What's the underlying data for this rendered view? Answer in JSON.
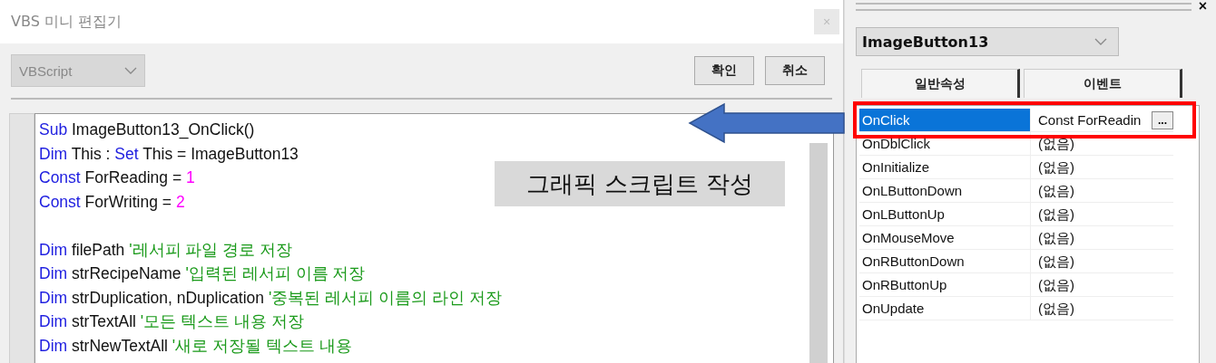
{
  "editor_window": {
    "title": "VBS 미니 편집기",
    "close": "×",
    "language_dropdown": {
      "value": "VBScript",
      "disabled": true
    },
    "buttons": [
      "확인",
      "취소"
    ],
    "code_lines": [
      {
        "segments": [
          {
            "kind": "keyword",
            "text": "Sub"
          },
          {
            "kind": "plain",
            "text": " ImageButton13_OnClick()"
          }
        ]
      },
      {
        "segments": [
          {
            "kind": "keyword",
            "text": "Dim"
          },
          {
            "kind": "plain",
            "text": " This : "
          },
          {
            "kind": "keyword",
            "text": "Set"
          },
          {
            "kind": "plain",
            "text": " This = ImageButton13"
          }
        ]
      },
      {
        "segments": [
          {
            "kind": "keyword",
            "text": "Const"
          },
          {
            "kind": "plain",
            "text": " ForReading = "
          },
          {
            "kind": "number",
            "text": "1"
          }
        ]
      },
      {
        "segments": [
          {
            "kind": "keyword",
            "text": "Const"
          },
          {
            "kind": "plain",
            "text": " ForWriting = "
          },
          {
            "kind": "number",
            "text": "2"
          }
        ]
      },
      {
        "kind": "blank"
      },
      {
        "segments": [
          {
            "kind": "keyword",
            "text": "Dim"
          },
          {
            "kind": "plain",
            "text": " filePath "
          },
          {
            "kind": "comment",
            "text": "'레서피 파일 경로 저장"
          }
        ]
      },
      {
        "segments": [
          {
            "kind": "keyword",
            "text": "Dim"
          },
          {
            "kind": "plain",
            "text": " strRecipeName "
          },
          {
            "kind": "comment",
            "text": "'입력된 레서피 이름 저장"
          }
        ]
      },
      {
        "segments": [
          {
            "kind": "keyword",
            "text": "Dim"
          },
          {
            "kind": "plain",
            "text": " strDuplication, nDuplication "
          },
          {
            "kind": "comment",
            "text": "'중복된 레서피 이름의 라인 저장"
          }
        ]
      },
      {
        "segments": [
          {
            "kind": "keyword",
            "text": "Dim"
          },
          {
            "kind": "plain",
            "text": " strTextAll "
          },
          {
            "kind": "comment",
            "text": "'모든 텍스트 내용 저장"
          }
        ]
      },
      {
        "segments": [
          {
            "kind": "keyword",
            "text": "Dim"
          },
          {
            "kind": "plain",
            "text": " strNewTextAll "
          },
          {
            "kind": "comment",
            "text": "'새로 저장될 텍스트 내용"
          }
        ]
      }
    ]
  },
  "annotation": {
    "label": "그래픽 스크립트 작성"
  },
  "properties_panel": {
    "close": "×",
    "object_dropdown": {
      "value": "ImageButton13"
    },
    "tabs": [
      "일반속성",
      "이벤트"
    ],
    "events": [
      {
        "name": "OnClick",
        "value": "Const ForReadin",
        "selected": true,
        "button": "..."
      },
      {
        "name": "OnDblClick",
        "value": "(없음)",
        "selected": false
      },
      {
        "name": "OnInitialize",
        "value": "(없음)",
        "selected": false
      },
      {
        "name": "OnLButtonDown",
        "value": "(없음)",
        "selected": false
      },
      {
        "name": "OnLButtonUp",
        "value": "(없음)",
        "selected": false
      },
      {
        "name": "OnMouseMove",
        "value": "(없음)",
        "selected": false
      },
      {
        "name": "OnRButtonDown",
        "value": "(없음)",
        "selected": false
      },
      {
        "name": "OnRButtonUp",
        "value": "(없음)",
        "selected": false
      },
      {
        "name": "OnUpdate",
        "value": "(없음)",
        "selected": false
      }
    ]
  }
}
